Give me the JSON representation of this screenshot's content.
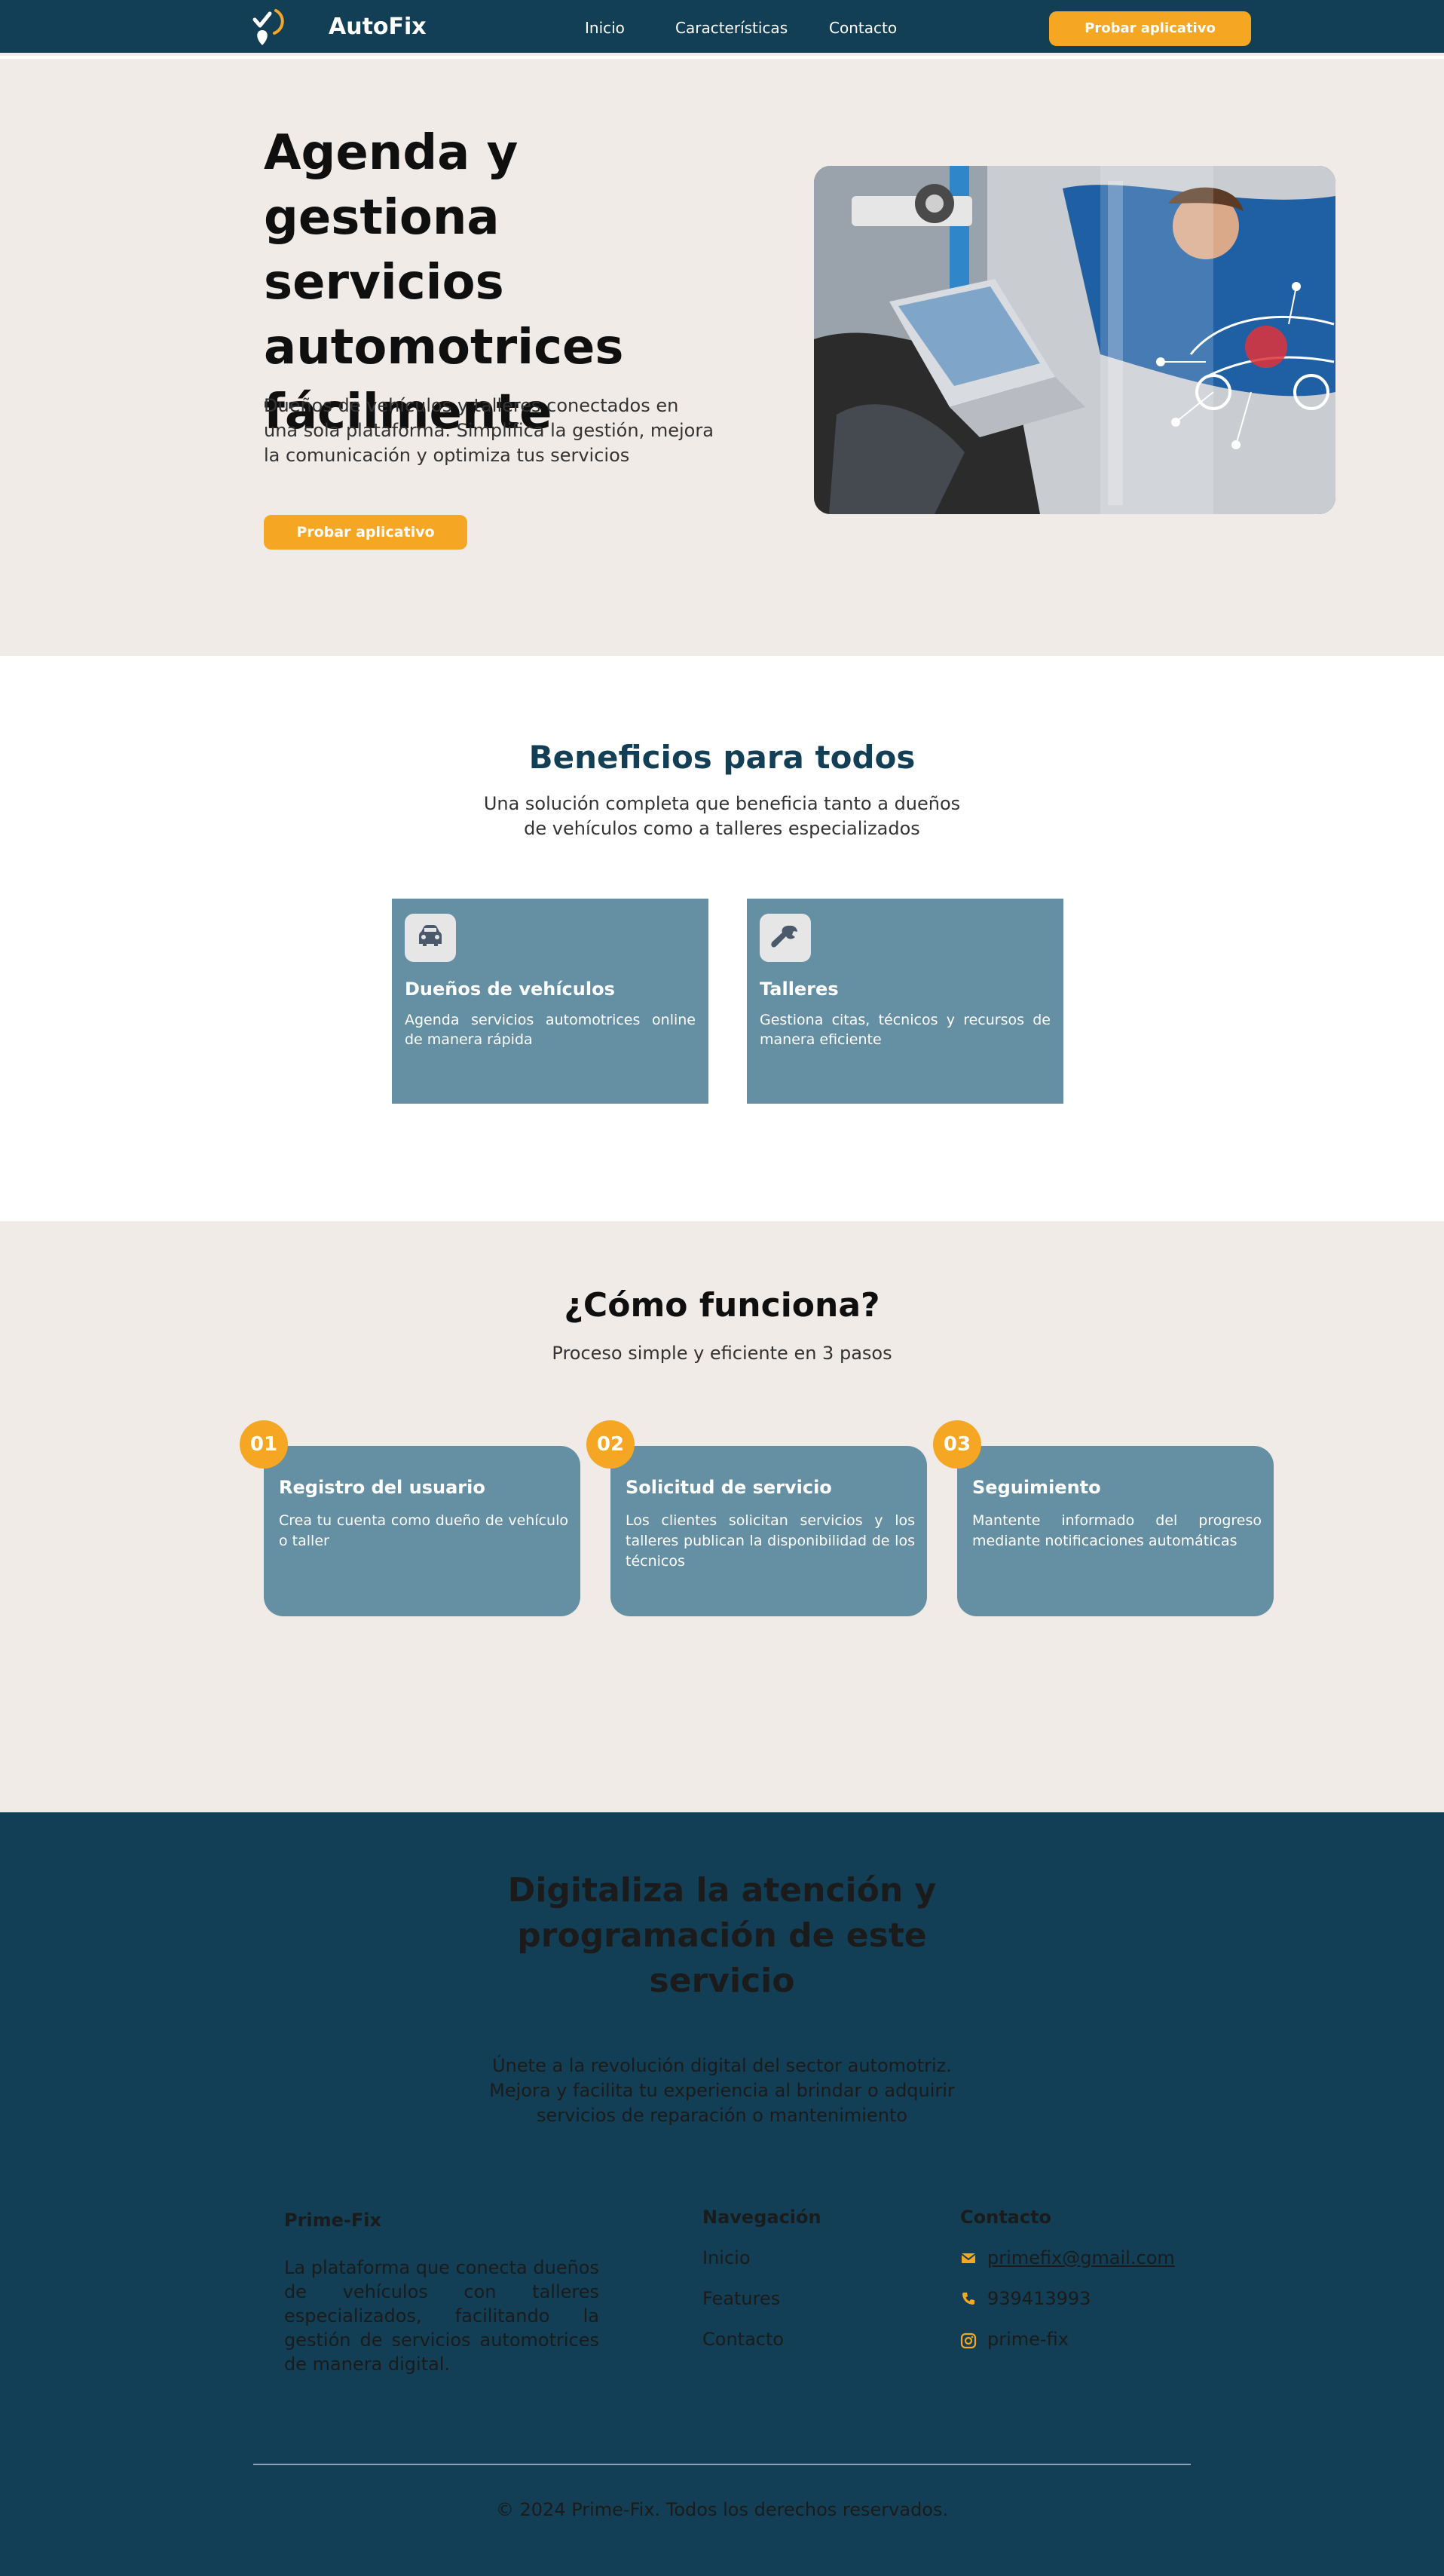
{
  "header": {
    "brand": "AutoFix",
    "nav": [
      "Inicio",
      "Características",
      "Contacto"
    ],
    "cta": "Probar aplicativo"
  },
  "hero": {
    "title": "Agenda y gestiona servicios automotrices fácilmente",
    "subtitle": "Dueños de vehículos y talleres conectados en una sola plataforma. Simplifica la gestión, mejora la comunicación y optimiza tus servicios",
    "cta": "Probar aplicativo"
  },
  "benefits": {
    "title": "Beneficios para todos",
    "subtitle": "Una solución completa que beneficia tanto a dueños de vehículos como a talleres especializados",
    "cards": [
      {
        "icon": "car-icon",
        "title": "Dueños de vehículos",
        "desc": "Agenda servicios automotrices online de manera rápida"
      },
      {
        "icon": "wrench-icon",
        "title": "Talleres",
        "desc": "Gestiona citas, técnicos y recursos de manera eficiente"
      }
    ]
  },
  "how": {
    "title": "¿Cómo funciona?",
    "subtitle": "Proceso simple y eficiente en 3 pasos",
    "steps": [
      {
        "num": "01",
        "title": "Registro del usuario",
        "desc": "Crea tu cuenta como dueño de vehículo o taller"
      },
      {
        "num": "02",
        "title": "Solicitud de servicio",
        "desc": "Los clientes solicitan servicios y los talleres publican la disponibilidad de los técnicos"
      },
      {
        "num": "03",
        "title": "Seguimiento",
        "desc": "Mantente informado del progreso mediante notificaciones automáticas"
      }
    ]
  },
  "cta_section": {
    "title": "Digitaliza la atención y programación de este servicio",
    "text": "Únete a la revolución digital del sector automotriz. Mejora y facilita tu experiencia al brindar o adquirir servicios de reparación o mantenimiento"
  },
  "footer": {
    "brand": "Prime-Fix",
    "desc": "La plataforma que conecta dueños de vehículos con talleres especializados, facilitando la gestión de servicios automotrices de manera digital.",
    "nav_heading": "Navegación",
    "nav_links": [
      "Inicio",
      "Features",
      "Contacto"
    ],
    "contact_heading": "Contacto",
    "email": "primefix@gmail.com",
    "phone": "939413993",
    "social": "prime-fix",
    "copyright": "© 2024 Prime-Fix. Todos los derechos reservados."
  },
  "colors": {
    "navy": "#123f55",
    "accent": "#f5a623",
    "card": "#658fa3",
    "beige": "#f0ebe7"
  },
  "icons": {
    "logo": "checkmark-pin-logo",
    "email": "mail-icon",
    "phone": "phone-icon",
    "social": "instagram-icon"
  }
}
